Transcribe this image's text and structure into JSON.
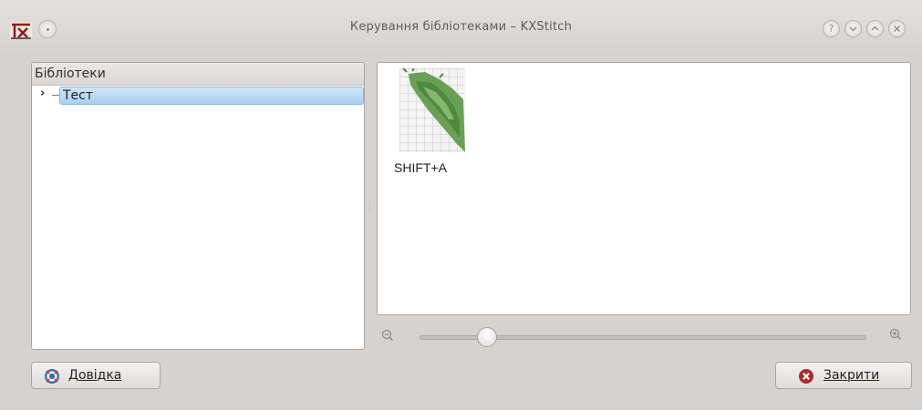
{
  "window": {
    "title": "Керування бібліотеками – KXStitch",
    "app_icon": "kxstitch-icon",
    "titlebar_buttons": [
      "help-icon",
      "minimize-icon",
      "maximize-icon",
      "close-icon"
    ]
  },
  "library_tree": {
    "header": "Бібліотеки",
    "items": [
      {
        "label": "Тест",
        "expanded": false,
        "selected": true
      }
    ]
  },
  "patterns": {
    "items": [
      {
        "label": "SHIFT+A"
      }
    ]
  },
  "zoom": {
    "level_fraction": 0.15,
    "zoom_out_icon": "zoom-out-icon",
    "zoom_in_icon": "zoom-in-icon"
  },
  "buttons": {
    "help_label": "Довідка",
    "close_label": "Закрити"
  },
  "colors": {
    "selection": "#a8d0f0",
    "close_icon": "#b0282a"
  }
}
